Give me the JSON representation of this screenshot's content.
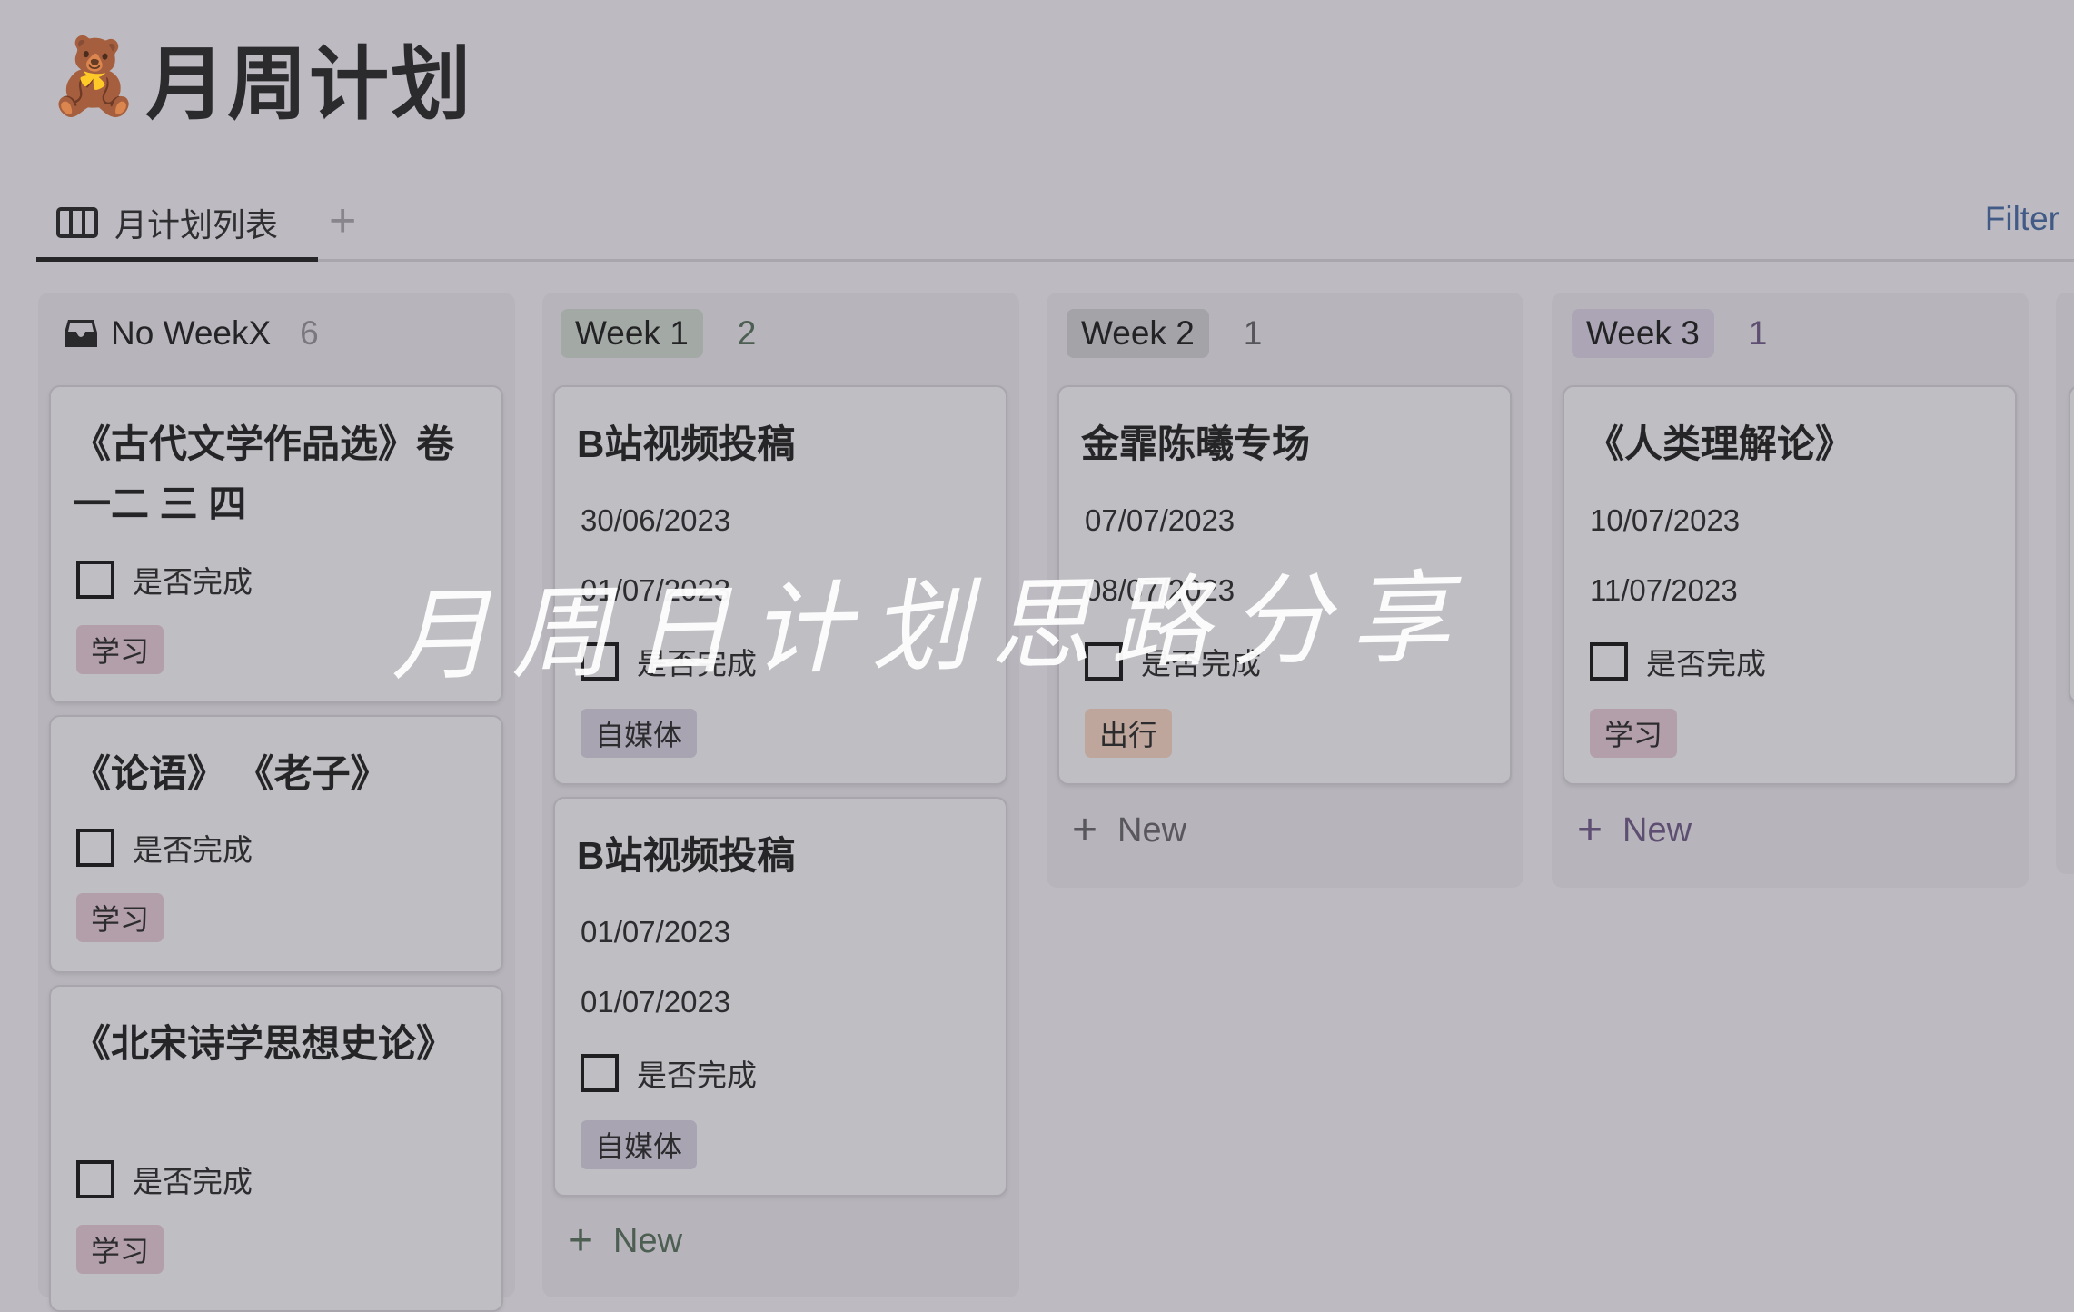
{
  "page": {
    "emoji": "🧸",
    "title": "月周计划"
  },
  "tabs": {
    "items": [
      {
        "label": "月计划列表",
        "icon": "board-columns-icon",
        "active": true
      }
    ],
    "add_label": "+",
    "filter_label": "Filter"
  },
  "columns": [
    {
      "name": "No WeekX",
      "count": "6",
      "icon": "inbox-icon",
      "cards": [
        {
          "title": "《古代文学作品选》卷一二 三 四",
          "dates": [],
          "checkbox_label": "是否完成",
          "checked": false,
          "tag": "学习"
        },
        {
          "title": "《论语》 《老子》",
          "dates": [],
          "checkbox_label": "是否完成",
          "checked": false,
          "tag": "学习"
        },
        {
          "title": "《北宋诗学思想史论》",
          "dates": [],
          "checkbox_label": "是否完成",
          "checked": false,
          "tag": "学习"
        }
      ]
    },
    {
      "name": "Week 1",
      "count": "2",
      "badge_color": "#a3aaa5",
      "count_color": "#4d5e52",
      "cards": [
        {
          "title": "B站视频投稿",
          "dates": [
            "30/06/2023",
            "01/07/2023"
          ],
          "checkbox_label": "是否完成",
          "checked": false,
          "tag": "自媒体"
        },
        {
          "title": "B站视频投稿",
          "dates": [
            "01/07/2023",
            "01/07/2023"
          ],
          "checkbox_label": "是否完成",
          "checked": false,
          "tag": "自媒体"
        }
      ],
      "new_label": "New"
    },
    {
      "name": "Week 2",
      "count": "1",
      "badge_color": "#a4a3a8",
      "count_color": "#55555a",
      "cards": [
        {
          "title": "金霏陈曦专场",
          "dates": [
            "07/07/2023",
            "08/07/2023"
          ],
          "checkbox_label": "是否完成",
          "checked": false,
          "tag": "出行"
        }
      ],
      "new_label": "New"
    },
    {
      "name": "Week 3",
      "count": "1",
      "badge_color": "#aba5b5",
      "count_color": "#5e4f72",
      "cards": [
        {
          "title": "《人类理解论》",
          "dates": [
            "10/07/2023",
            "11/07/2023"
          ],
          "checkbox_label": "是否完成",
          "checked": false,
          "tag": "学习"
        }
      ],
      "new_label": "New"
    }
  ],
  "overlay_text": "月周日计划思路分享"
}
